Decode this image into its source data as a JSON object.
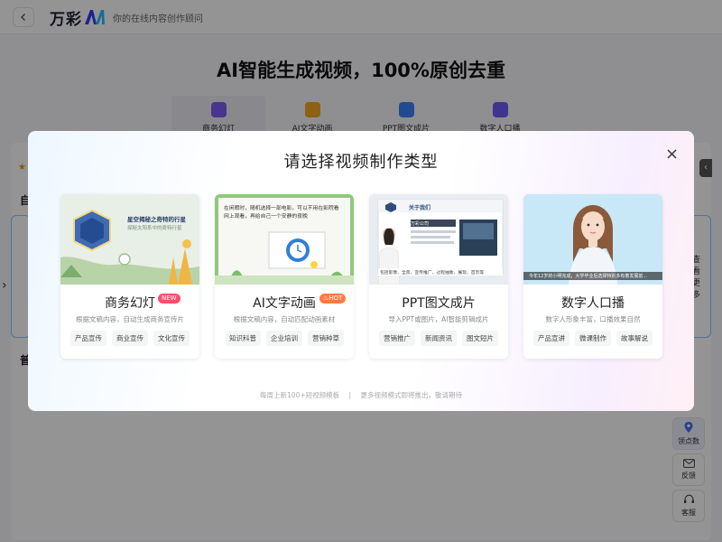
{
  "header": {
    "logo_text": "万彩",
    "logo_mark": "AI",
    "slogan": "你的在线内容创作顾问"
  },
  "background": {
    "hero_title": "AI智能生成视频，100%原创去重",
    "tabs": [
      {
        "label": "商务幻灯",
        "color": "#7a5cf5"
      },
      {
        "label": "AI文字动画",
        "color": "#f5a623"
      },
      {
        "label": "PPT图文成片",
        "color": "#3b82f6"
      },
      {
        "label": "数字人口播",
        "color": "#6d5cf5"
      }
    ],
    "section1_label": "自",
    "section2_label": "普",
    "see_more": "查看更多"
  },
  "float_bar": {
    "items": [
      {
        "label": "领点数",
        "icon": "location-pin-icon"
      },
      {
        "label": "反馈",
        "icon": "mail-icon"
      },
      {
        "label": "客服",
        "icon": "headset-icon"
      }
    ]
  },
  "modal": {
    "title": "请选择视频制作类型",
    "cards": [
      {
        "name": "商务幻灯",
        "badge": "NEW",
        "desc": "根据文稿内容，自动生成商务宣传片",
        "tags": [
          "产品宣传",
          "商业宣传",
          "文化宣传"
        ],
        "thumb_title": "星空揭秘之奇特的行星",
        "thumb_sub": "探秘太阳系中的奇特行星"
      },
      {
        "name": "AI文字动画",
        "badge": "HOT",
        "desc": "根据文稿内容，自动匹配动画素材",
        "tags": [
          "知识科普",
          "企业培训",
          "营销种草"
        ],
        "thumb_line1": "在闲暇时，随机选择一部电影，可以不用在影院看",
        "thumb_line2": "网上观看，再给自己一个安静的夜晚"
      },
      {
        "name": "PPT图文成片",
        "badge": "",
        "desc": "导入PPT或图片，AI智能剪辑成片",
        "tags": [
          "营销推广",
          "新闻资讯",
          "图文短片"
        ],
        "thumb_title": "关于我们",
        "thumb_sub": "万彩公司",
        "thumb_caption": "包括影像、全景、宣传推广、过程抽象、展现、首页等"
      },
      {
        "name": "数字人口播",
        "badge": "",
        "desc": "数字人形象丰富，口播效果自然",
        "tags": [
          "产品宣讲",
          "微课制作",
          "故事解说"
        ],
        "thumb_caption": "今年12岁的小明完成，大学毕业后选择特别多有着发展前..."
      }
    ],
    "footer_left": "每周上新100+短视频模板",
    "footer_sep": "|",
    "footer_right": "更多视频模式即将推出，敬请期待"
  }
}
